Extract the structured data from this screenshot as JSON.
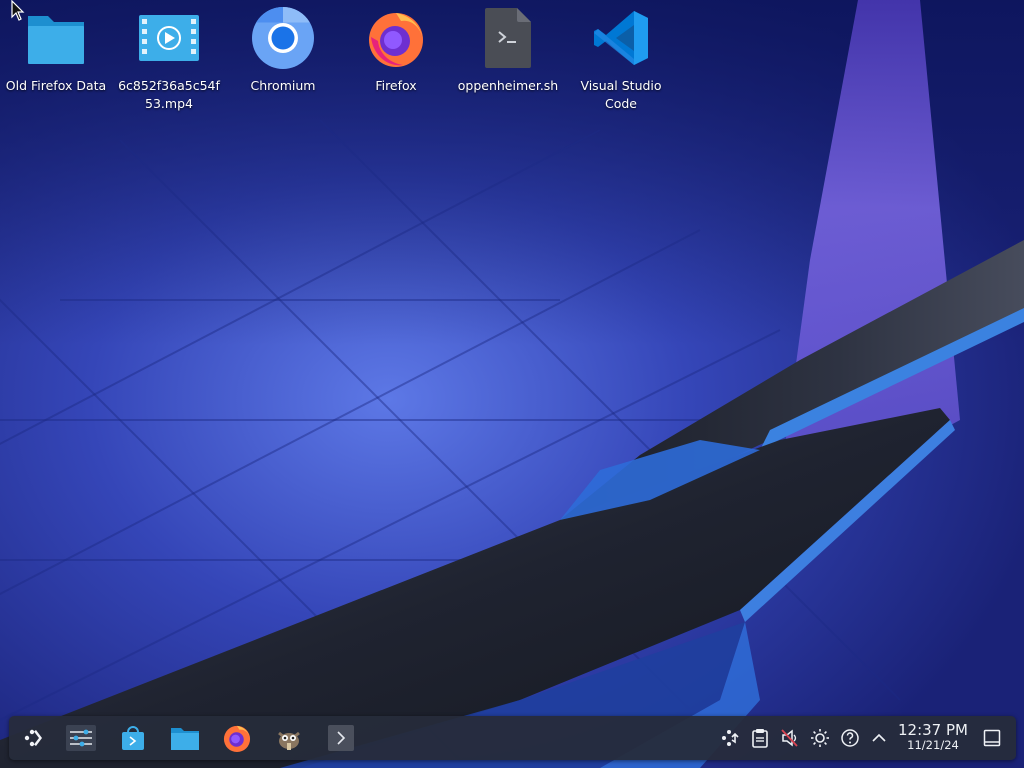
{
  "desktop": {
    "icons": [
      {
        "name": "folder-icon",
        "label": "Old Firefox Data"
      },
      {
        "name": "video-file-icon",
        "label": "6c852f36a5c54f\n53.mp4"
      },
      {
        "name": "chromium-icon",
        "label": "Chromium"
      },
      {
        "name": "firefox-icon",
        "label": "Firefox"
      },
      {
        "name": "shell-script-icon",
        "label": "oppenheimer.sh"
      },
      {
        "name": "vscode-icon",
        "label": "Visual Studio\nCode"
      }
    ]
  },
  "taskbar": {
    "launchers": [
      {
        "name": "application-launcher-icon"
      },
      {
        "name": "system-settings-icon"
      },
      {
        "name": "discover-store-icon"
      },
      {
        "name": "file-manager-icon"
      },
      {
        "name": "firefox-icon"
      },
      {
        "name": "gimp-icon"
      },
      {
        "name": "terminal-icon"
      }
    ],
    "tray": [
      {
        "name": "network-icon"
      },
      {
        "name": "clipboard-icon"
      },
      {
        "name": "volume-muted-icon"
      },
      {
        "name": "brightness-icon"
      },
      {
        "name": "help-icon"
      },
      {
        "name": "chevron-up-icon"
      }
    ],
    "clock": {
      "time": "12:37 PM",
      "date": "11/21/24"
    },
    "show_desktop": {
      "name": "show-desktop-icon"
    }
  },
  "colors": {
    "panel": "#262c3a",
    "accent_blue": "#3daee9",
    "wallpaper_base": "#1e2a8a"
  }
}
